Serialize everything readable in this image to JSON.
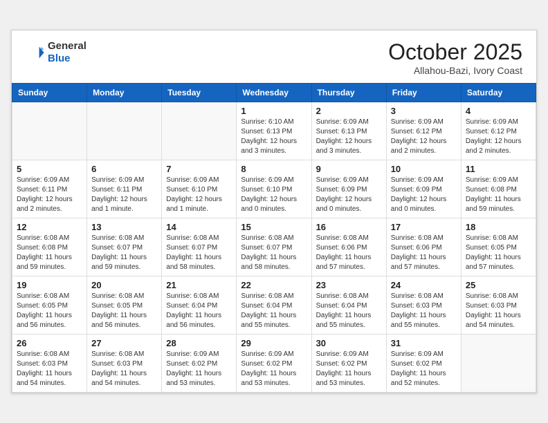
{
  "header": {
    "logo": {
      "general": "General",
      "blue": "Blue"
    },
    "month_title": "October 2025",
    "location": "Allahou-Bazi, Ivory Coast"
  },
  "weekdays": [
    "Sunday",
    "Monday",
    "Tuesday",
    "Wednesday",
    "Thursday",
    "Friday",
    "Saturday"
  ],
  "weeks": [
    [
      {
        "day": "",
        "info": ""
      },
      {
        "day": "",
        "info": ""
      },
      {
        "day": "",
        "info": ""
      },
      {
        "day": "1",
        "info": "Sunrise: 6:10 AM\nSunset: 6:13 PM\nDaylight: 12 hours and 3 minutes."
      },
      {
        "day": "2",
        "info": "Sunrise: 6:09 AM\nSunset: 6:13 PM\nDaylight: 12 hours and 3 minutes."
      },
      {
        "day": "3",
        "info": "Sunrise: 6:09 AM\nSunset: 6:12 PM\nDaylight: 12 hours and 2 minutes."
      },
      {
        "day": "4",
        "info": "Sunrise: 6:09 AM\nSunset: 6:12 PM\nDaylight: 12 hours and 2 minutes."
      }
    ],
    [
      {
        "day": "5",
        "info": "Sunrise: 6:09 AM\nSunset: 6:11 PM\nDaylight: 12 hours and 2 minutes."
      },
      {
        "day": "6",
        "info": "Sunrise: 6:09 AM\nSunset: 6:11 PM\nDaylight: 12 hours and 1 minute."
      },
      {
        "day": "7",
        "info": "Sunrise: 6:09 AM\nSunset: 6:10 PM\nDaylight: 12 hours and 1 minute."
      },
      {
        "day": "8",
        "info": "Sunrise: 6:09 AM\nSunset: 6:10 PM\nDaylight: 12 hours and 0 minutes."
      },
      {
        "day": "9",
        "info": "Sunrise: 6:09 AM\nSunset: 6:09 PM\nDaylight: 12 hours and 0 minutes."
      },
      {
        "day": "10",
        "info": "Sunrise: 6:09 AM\nSunset: 6:09 PM\nDaylight: 12 hours and 0 minutes."
      },
      {
        "day": "11",
        "info": "Sunrise: 6:09 AM\nSunset: 6:08 PM\nDaylight: 11 hours and 59 minutes."
      }
    ],
    [
      {
        "day": "12",
        "info": "Sunrise: 6:08 AM\nSunset: 6:08 PM\nDaylight: 11 hours and 59 minutes."
      },
      {
        "day": "13",
        "info": "Sunrise: 6:08 AM\nSunset: 6:07 PM\nDaylight: 11 hours and 59 minutes."
      },
      {
        "day": "14",
        "info": "Sunrise: 6:08 AM\nSunset: 6:07 PM\nDaylight: 11 hours and 58 minutes."
      },
      {
        "day": "15",
        "info": "Sunrise: 6:08 AM\nSunset: 6:07 PM\nDaylight: 11 hours and 58 minutes."
      },
      {
        "day": "16",
        "info": "Sunrise: 6:08 AM\nSunset: 6:06 PM\nDaylight: 11 hours and 57 minutes."
      },
      {
        "day": "17",
        "info": "Sunrise: 6:08 AM\nSunset: 6:06 PM\nDaylight: 11 hours and 57 minutes."
      },
      {
        "day": "18",
        "info": "Sunrise: 6:08 AM\nSunset: 6:05 PM\nDaylight: 11 hours and 57 minutes."
      }
    ],
    [
      {
        "day": "19",
        "info": "Sunrise: 6:08 AM\nSunset: 6:05 PM\nDaylight: 11 hours and 56 minutes."
      },
      {
        "day": "20",
        "info": "Sunrise: 6:08 AM\nSunset: 6:05 PM\nDaylight: 11 hours and 56 minutes."
      },
      {
        "day": "21",
        "info": "Sunrise: 6:08 AM\nSunset: 6:04 PM\nDaylight: 11 hours and 56 minutes."
      },
      {
        "day": "22",
        "info": "Sunrise: 6:08 AM\nSunset: 6:04 PM\nDaylight: 11 hours and 55 minutes."
      },
      {
        "day": "23",
        "info": "Sunrise: 6:08 AM\nSunset: 6:04 PM\nDaylight: 11 hours and 55 minutes."
      },
      {
        "day": "24",
        "info": "Sunrise: 6:08 AM\nSunset: 6:03 PM\nDaylight: 11 hours and 55 minutes."
      },
      {
        "day": "25",
        "info": "Sunrise: 6:08 AM\nSunset: 6:03 PM\nDaylight: 11 hours and 54 minutes."
      }
    ],
    [
      {
        "day": "26",
        "info": "Sunrise: 6:08 AM\nSunset: 6:03 PM\nDaylight: 11 hours and 54 minutes."
      },
      {
        "day": "27",
        "info": "Sunrise: 6:08 AM\nSunset: 6:03 PM\nDaylight: 11 hours and 54 minutes."
      },
      {
        "day": "28",
        "info": "Sunrise: 6:09 AM\nSunset: 6:02 PM\nDaylight: 11 hours and 53 minutes."
      },
      {
        "day": "29",
        "info": "Sunrise: 6:09 AM\nSunset: 6:02 PM\nDaylight: 11 hours and 53 minutes."
      },
      {
        "day": "30",
        "info": "Sunrise: 6:09 AM\nSunset: 6:02 PM\nDaylight: 11 hours and 53 minutes."
      },
      {
        "day": "31",
        "info": "Sunrise: 6:09 AM\nSunset: 6:02 PM\nDaylight: 11 hours and 52 minutes."
      },
      {
        "day": "",
        "info": ""
      }
    ]
  ]
}
